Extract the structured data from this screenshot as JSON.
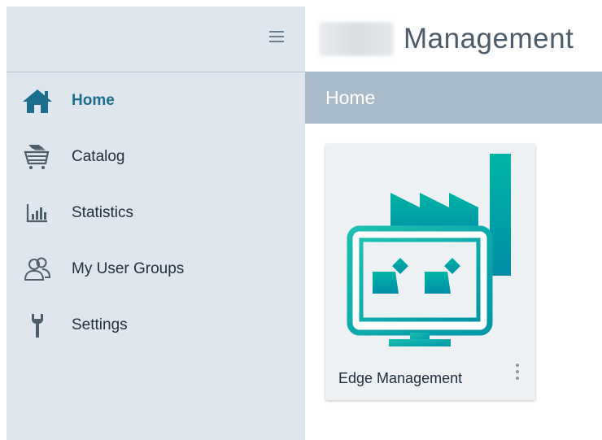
{
  "header": {
    "title": "Management"
  },
  "sidebar": {
    "menu_icon": "hamburger-icon",
    "items": [
      {
        "label": "Home",
        "icon": "home-icon",
        "active": true
      },
      {
        "label": "Catalog",
        "icon": "cart-icon",
        "active": false
      },
      {
        "label": "Statistics",
        "icon": "bar-chart-icon",
        "active": false
      },
      {
        "label": "My User Groups",
        "icon": "user-group-icon",
        "active": false
      },
      {
        "label": "Settings",
        "icon": "wrench-icon",
        "active": false
      }
    ]
  },
  "breadcrumb": {
    "current": "Home"
  },
  "tiles": [
    {
      "label": "Edge Management",
      "icon": "factory-monitor-icon",
      "menu_icon": "kebab-menu-icon"
    }
  ],
  "colors": {
    "accent": "#1b6e8c",
    "teal": "#00a3a3",
    "sidebar_bg": "#dfe6ed",
    "breadcrumb_bg": "#aabbc9"
  }
}
